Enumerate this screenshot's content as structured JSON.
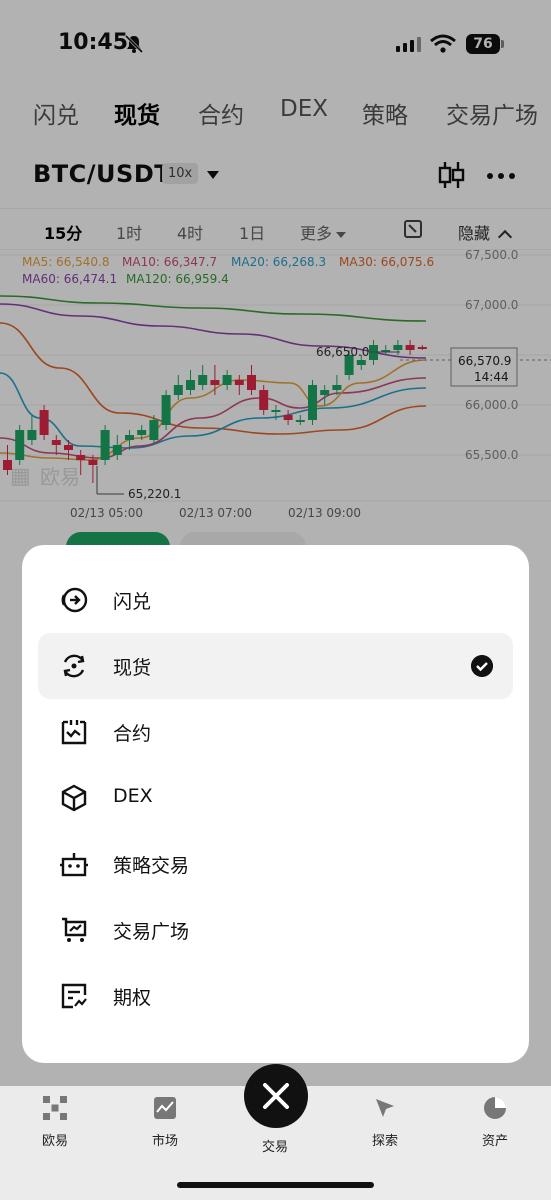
{
  "status": {
    "time": "10:45",
    "battery": "76"
  },
  "top_tabs": [
    "闪兑",
    "现货",
    "合约",
    "DEX",
    "策略",
    "交易广场"
  ],
  "pair": {
    "symbol": "BTC/USDT",
    "leverage": "10x"
  },
  "intervals": {
    "items": [
      "15分",
      "1时",
      "4时",
      "1日"
    ],
    "more": "更多",
    "hide": "隐藏"
  },
  "chart_data": {
    "type": "candlestick",
    "ma_legend": [
      {
        "label": "MA5: 66,540.8",
        "color": "#e6a23c"
      },
      {
        "label": "MA10: 66,347.7",
        "color": "#c94f7c"
      },
      {
        "label": "MA20: 66,268.3",
        "color": "#2a9fc9"
      },
      {
        "label": "MA30: 66,075.6",
        "color": "#e0662a"
      },
      {
        "label": "MA60: 66,474.1",
        "color": "#8e44ad"
      },
      {
        "label": "MA120: 66,959.4",
        "color": "#3a9a3a"
      }
    ],
    "y_ticks": [
      "67,500.0",
      "67,000.0",
      "66,000.0",
      "65,500.0"
    ],
    "x_ticks": [
      "02/13 05:00",
      "02/13 07:00",
      "02/13 09:00"
    ],
    "high_label": "66,650.0",
    "low_label": "65,220.1",
    "price_tag": "66,570.9",
    "countdown": "14:44",
    "watermark": "欧易",
    "up_color": "#1fa664",
    "down_color": "#e0294a"
  },
  "menu": [
    {
      "label": "闪兑",
      "icon": "flash-swap-icon",
      "selected": false
    },
    {
      "label": "现货",
      "icon": "spot-icon",
      "selected": true
    },
    {
      "label": "合约",
      "icon": "futures-icon",
      "selected": false
    },
    {
      "label": "DEX",
      "icon": "dex-cube-icon",
      "selected": false
    },
    {
      "label": "策略交易",
      "icon": "bot-icon",
      "selected": false
    },
    {
      "label": "交易广场",
      "icon": "trading-square-icon",
      "selected": false
    },
    {
      "label": "期权",
      "icon": "options-icon",
      "selected": false
    }
  ],
  "bottom_nav": [
    "欧易",
    "市场",
    "交易",
    "探索",
    "资产"
  ]
}
